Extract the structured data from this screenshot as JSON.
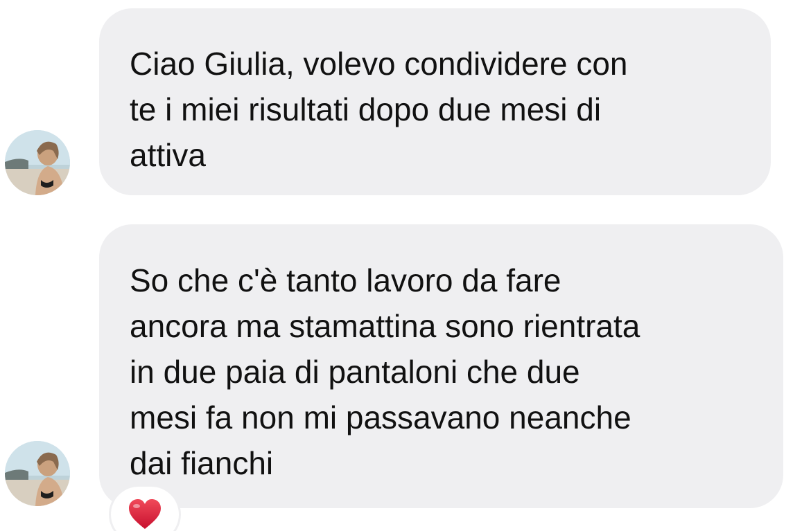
{
  "messages": [
    {
      "lines": [
        "Ciao Giulia,  volevo condividere con",
        "te i miei risultati dopo due mesi di",
        "attiva"
      ]
    },
    {
      "lines": [
        "So che c'è tanto lavoro da fare",
        "ancora ma stamattina sono rientrata",
        "in due paia di pantaloni che due",
        "mesi fa non mi passavano neanche",
        "dai fianchi"
      ],
      "reaction": "heart-icon"
    }
  ],
  "colors": {
    "bubble": "#efeff1",
    "text": "#111111",
    "heart": "#e0283b"
  }
}
